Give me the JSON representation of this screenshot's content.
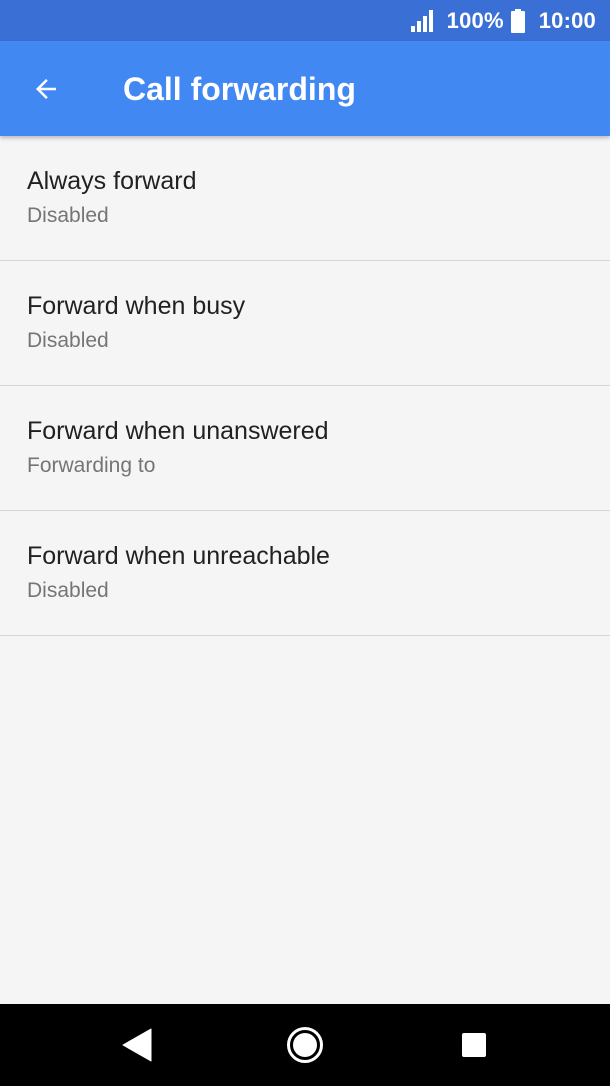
{
  "status_bar": {
    "battery": "100%",
    "time": "10:00",
    "icons": [
      "signal-icon",
      "battery-icon"
    ]
  },
  "app_bar": {
    "title": "Call forwarding",
    "back_icon": "arrow-left-icon",
    "color": "#4188f2",
    "status_color": "#3a6fd6"
  },
  "settings": {
    "items": [
      {
        "title": "Always forward",
        "summary": "Disabled"
      },
      {
        "title": "Forward when busy",
        "summary": "Disabled"
      },
      {
        "title": "Forward when unanswered",
        "summary": "Forwarding to"
      },
      {
        "title": "Forward when unreachable",
        "summary": "Disabled"
      }
    ]
  },
  "nav_bar": {
    "icons": [
      "nav-back-icon",
      "nav-home-icon",
      "nav-recents-icon"
    ]
  }
}
